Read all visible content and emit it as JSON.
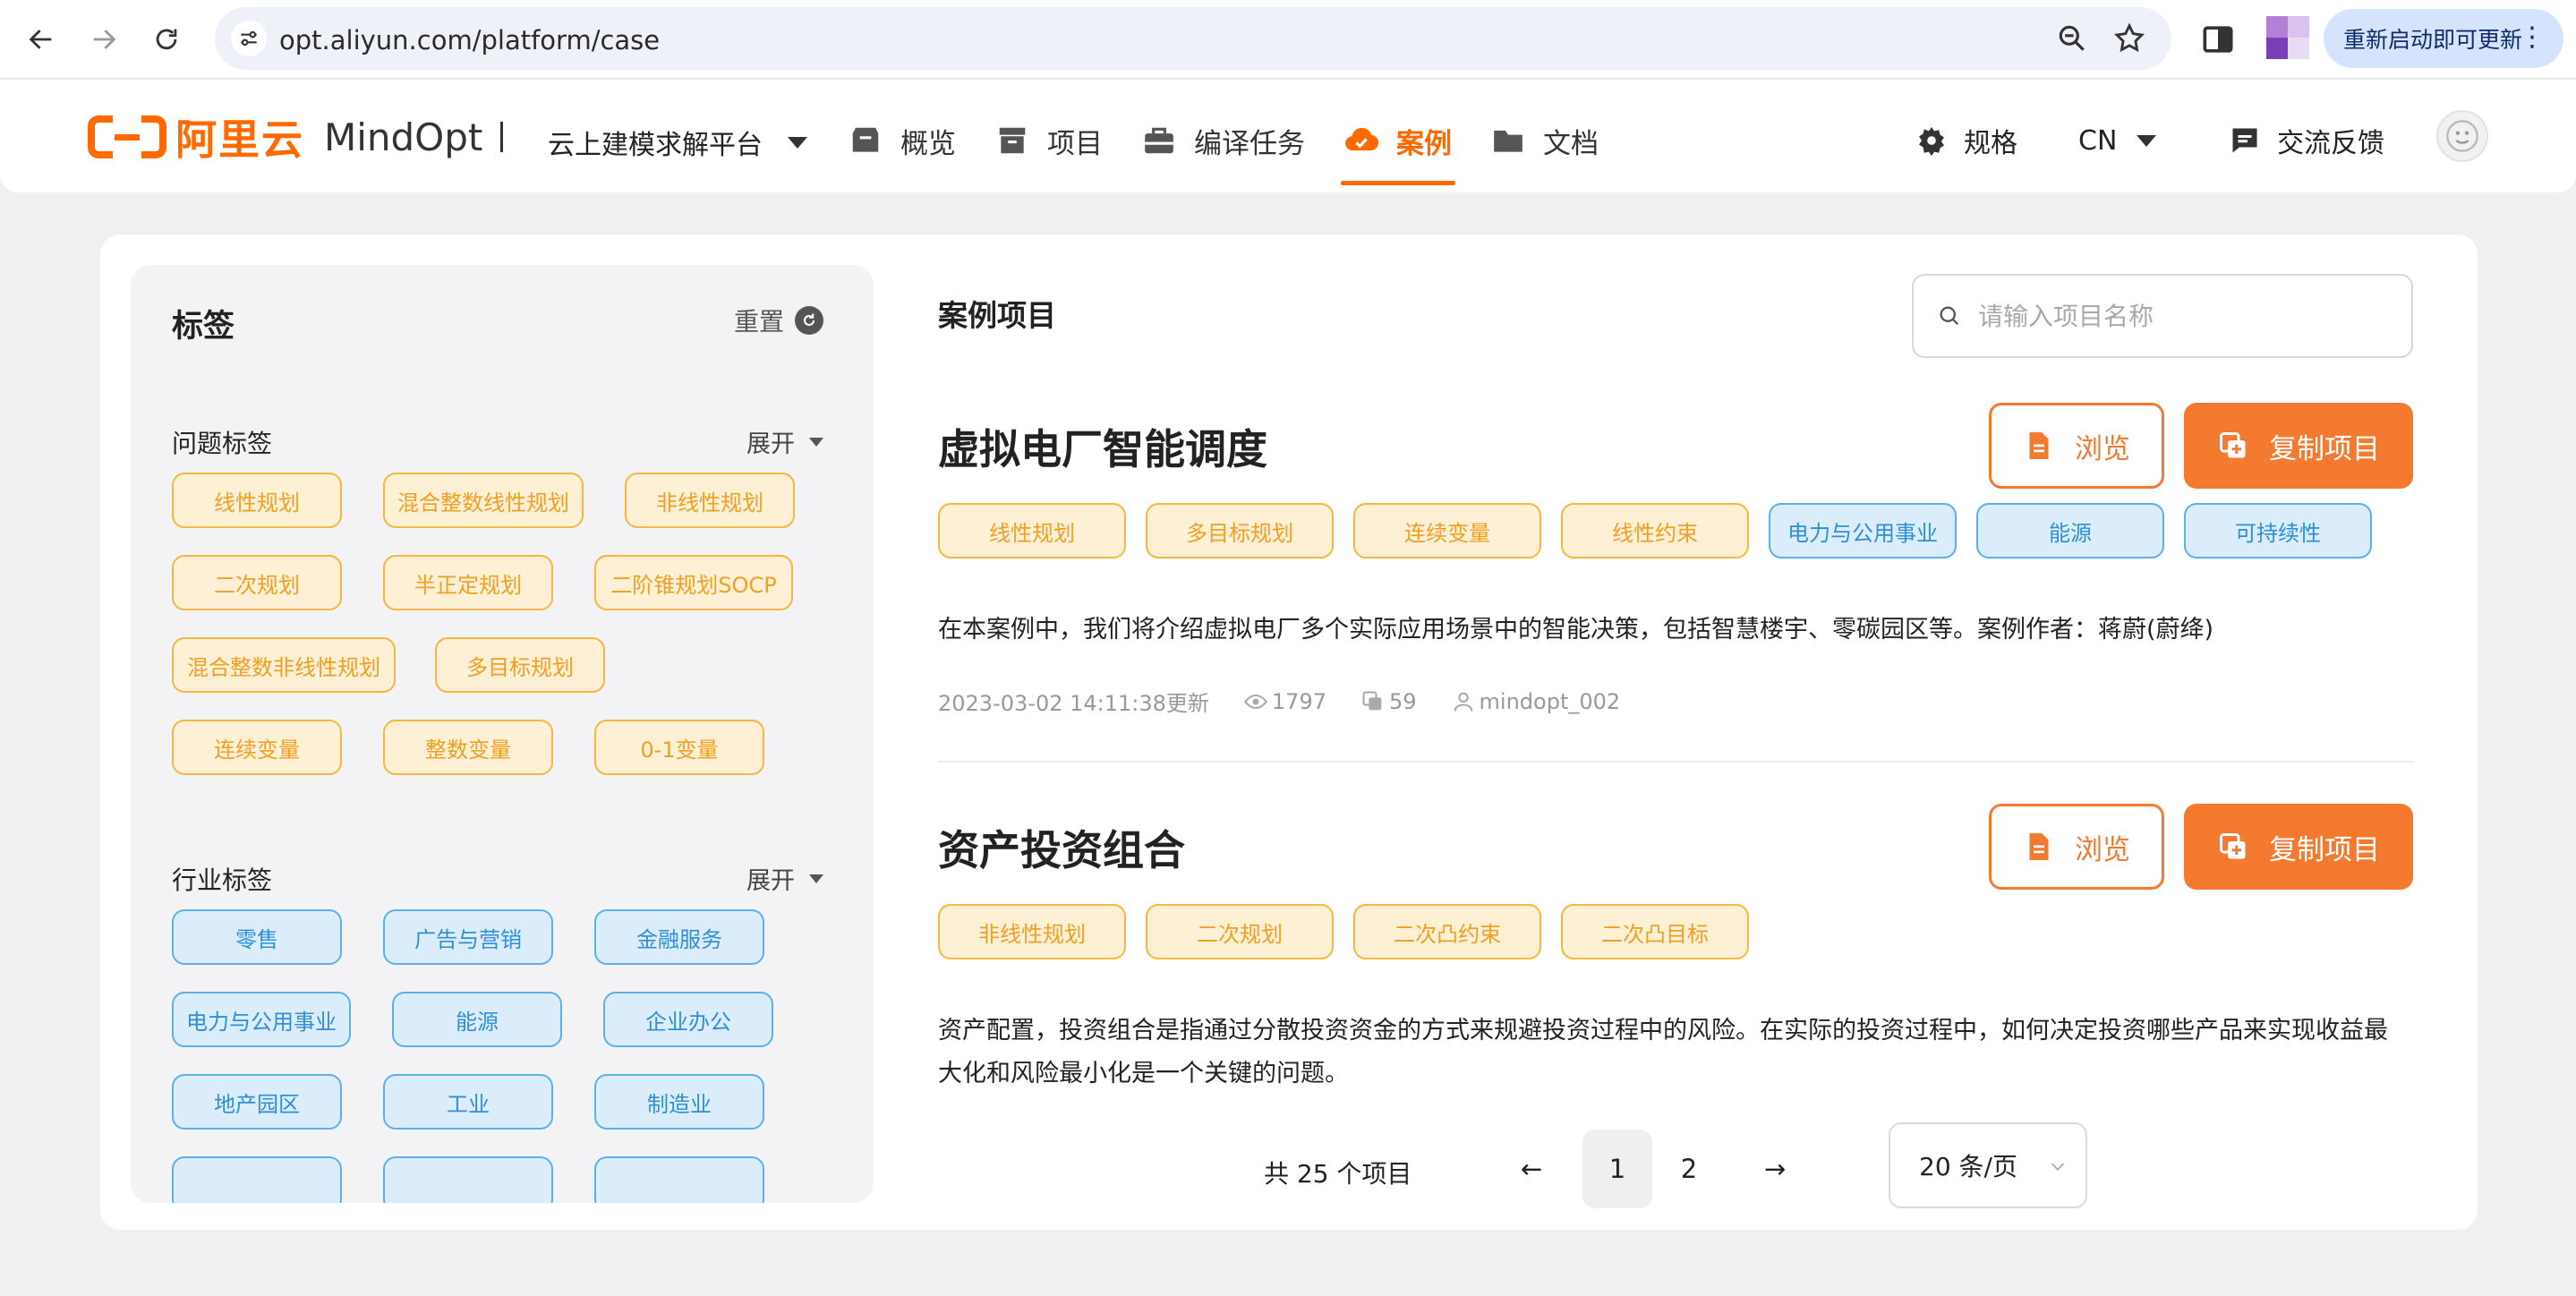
{
  "browser": {
    "url": "opt.aliyun.com/platform/case",
    "update_button_label": "重新启动即可更新"
  },
  "header": {
    "logo_cn": "阿里云",
    "logo_en": "MindOpt",
    "platform_select": "云上建模求解平台",
    "nav": [
      {
        "label": "概览",
        "icon": "box-icon"
      },
      {
        "label": "项目",
        "icon": "archive-icon"
      },
      {
        "label": "编译任务",
        "icon": "briefcase-icon"
      },
      {
        "label": "案例",
        "icon": "cloud-icon",
        "active": true
      },
      {
        "label": "文档",
        "icon": "folder-icon"
      }
    ],
    "spec_label": "规格",
    "lang_label": "CN",
    "feedback_label": "交流反馈",
    "accent_color": "#ff6a00"
  },
  "sidebar": {
    "title": "标签",
    "reset_label": "重置",
    "problem_section": {
      "title": "问题标签",
      "expand_label": "展开",
      "tags": [
        "线性规划",
        "混合整数线性规划",
        "非线性规划",
        "二次规划",
        "半正定规划",
        "二阶锥规划SOCP",
        "混合整数非线性规划",
        "多目标规划",
        "连续变量",
        "整数变量",
        "0-1变量"
      ]
    },
    "industry_section": {
      "title": "行业标签",
      "expand_label": "展开",
      "tags": [
        "零售",
        "广告与营销",
        "金融服务",
        "电力与公用事业",
        "能源",
        "企业办公",
        "地产园区",
        "工业",
        "制造业"
      ]
    }
  },
  "main": {
    "title": "案例项目",
    "search_placeholder": "请输入项目名称",
    "browse_label": "浏览",
    "copy_label": "复制项目",
    "projects": [
      {
        "name": "虚拟电厂智能调度",
        "problem_tags": [
          "线性规划",
          "多目标规划",
          "连续变量",
          "线性约束"
        ],
        "industry_tags": [
          "电力与公用事业",
          "能源",
          "可持续性"
        ],
        "description": "在本案例中，我们将介绍虚拟电厂多个实际应用场景中的智能决策，包括智慧楼宇、零碳园区等。案例作者：蒋蔚(蔚绛)",
        "updated": "2023-03-02 14:11:38更新",
        "views": "1797",
        "copies": "59",
        "author": "mindopt_002"
      },
      {
        "name": "资产投资组合",
        "problem_tags": [
          "非线性规划",
          "二次规划",
          "二次凸约束",
          "二次凸目标"
        ],
        "industry_tags": [],
        "description": "资产配置，投资组合是指通过分散投资资金的方式来规避投资过程中的风险。在实际的投资过程中，如何决定投资哪些产品来实现收益最大化和风险最小化是一个关键的问题。"
      }
    ]
  },
  "pagination": {
    "total_label": "共 25 个项目",
    "prev": "←",
    "next": "→",
    "pages": [
      "1",
      "2"
    ],
    "current_page": "1",
    "page_size_label": "20 条/页"
  },
  "colors": {
    "tag_orange_bg": "#fdf0d5",
    "tag_orange_border": "#f6b63f",
    "tag_blue_bg": "#dbecfa",
    "tag_blue_border": "#5ab0ee",
    "button_orange": "#f47a2f"
  }
}
